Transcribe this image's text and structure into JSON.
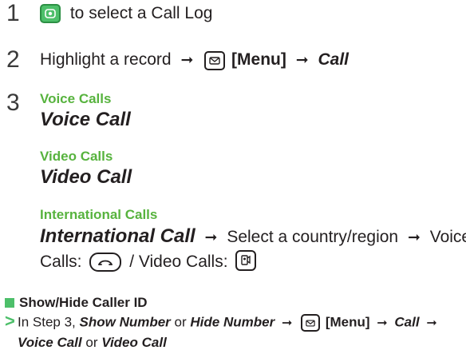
{
  "steps": [
    {
      "number": "1",
      "key_icon": "nav-key-icon",
      "text": "to select a Call Log"
    },
    {
      "number": "2",
      "text_before": "Highlight a record",
      "key_icon": "mail-key-icon",
      "menu_label": "[Menu]",
      "action": "Call"
    },
    {
      "number": "3",
      "options": [
        {
          "heading": "Voice Calls",
          "command": "Voice Call"
        },
        {
          "heading": "Video Calls",
          "command": "Video Call"
        },
        {
          "heading": "International Calls",
          "command": "International Call"
        }
      ],
      "intl_select": "Select a country/region",
      "intl_voice": "Voice",
      "intl_calls_voice": "Calls:",
      "intl_separator": "/ Video Calls:",
      "call_key_icon": "call-key-icon",
      "video_key_icon": "video-key-icon"
    }
  ],
  "section": {
    "title": "Show/Hide Caller ID",
    "marker_color": "#4dbf6a",
    "note": {
      "prefix": "In Step 3,",
      "show_number": "Show Number",
      "or1": "or",
      "hide_number": "Hide Number",
      "menu_label": "[Menu]",
      "call": "Call",
      "voice_call": "Voice Call",
      "or2": "or",
      "video_call": "Video Call"
    }
  },
  "colors": {
    "heading_green": "#57b33e",
    "text": "#231f20",
    "accent_green": "#4dbf6a"
  }
}
